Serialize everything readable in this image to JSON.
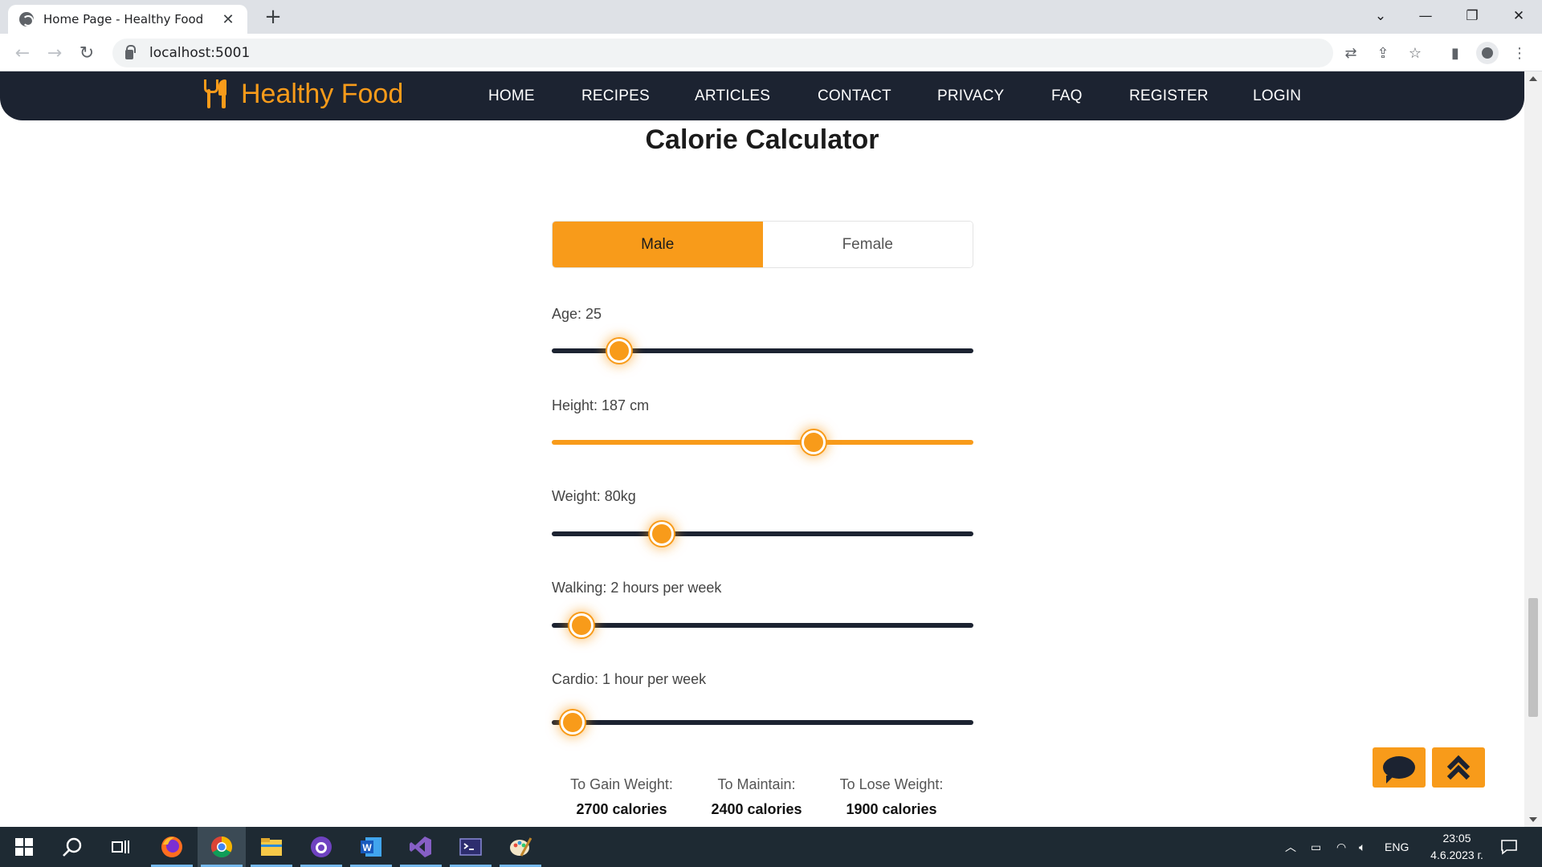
{
  "browser": {
    "tab_title": "Home Page - Healthy Food",
    "tab_close": "✕",
    "new_tab": "+",
    "url": "localhost:5001",
    "window_controls": {
      "tabsearch": "⌄",
      "minimize": "—",
      "restore": "❐",
      "close": "✕"
    }
  },
  "site": {
    "brand": "Healthy Food",
    "menu": [
      "HOME",
      "RECIPES",
      "ARTICLES",
      "CONTACT",
      "PRIVACY",
      "FAQ",
      "REGISTER",
      "LOGIN"
    ],
    "colors": {
      "accent": "#f89b1a",
      "navbar": "#1c2331"
    }
  },
  "calculator": {
    "title": "Calorie Calculator",
    "gender": {
      "options": [
        "Male",
        "Female"
      ],
      "selected": "Male"
    },
    "sliders": [
      {
        "label": "Age: 25",
        "value_fraction": 0.16
      },
      {
        "label": "Height: 187 cm",
        "value_fraction": 0.62
      },
      {
        "label": "Weight: 80kg",
        "value_fraction": 0.26
      },
      {
        "label": "Walking: 2 hours per week",
        "value_fraction": 0.07
      },
      {
        "label": "Cardio: 1 hour per week",
        "value_fraction": 0.05
      }
    ],
    "results": [
      {
        "label": "To Gain Weight:",
        "value": "2700 calories"
      },
      {
        "label": "To Maintain:",
        "value": "2400 calories"
      },
      {
        "label": "To Lose Weight:",
        "value": "1900 calories"
      }
    ]
  },
  "floating_buttons": {
    "chat": "chat-bubble-icon",
    "top": "double-chevron-up-icon"
  },
  "taskbar": {
    "apps": [
      "start",
      "search",
      "task-view",
      "firefox",
      "chrome",
      "file-explorer",
      "github-desktop",
      "word",
      "visual-studio",
      "terminal",
      "paint"
    ],
    "language": "ENG",
    "time": "23:05",
    "date": "4.6.2023 г."
  }
}
